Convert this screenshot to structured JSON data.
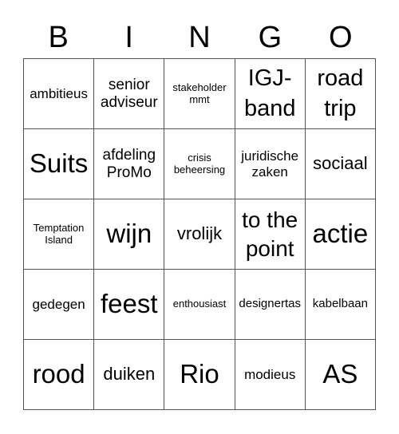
{
  "header": [
    "B",
    "I",
    "N",
    "G",
    "O"
  ],
  "cells": [
    [
      "ambitieus",
      "senior adviseur",
      "stakeholder mmt",
      "IGJ-band",
      "road trip"
    ],
    [
      "Suits",
      "afdeling ProMo",
      "crisis beheersing",
      "juridische zaken",
      "sociaal"
    ],
    [
      "Temptation Island",
      "wijn",
      "vrolijk",
      "to the point",
      "actie"
    ],
    [
      "gedegen",
      "feest",
      "enthousiast",
      "designertas",
      "kabelbaan"
    ],
    [
      "rood",
      "duiken",
      "Rio",
      "modieus",
      "AS"
    ]
  ]
}
